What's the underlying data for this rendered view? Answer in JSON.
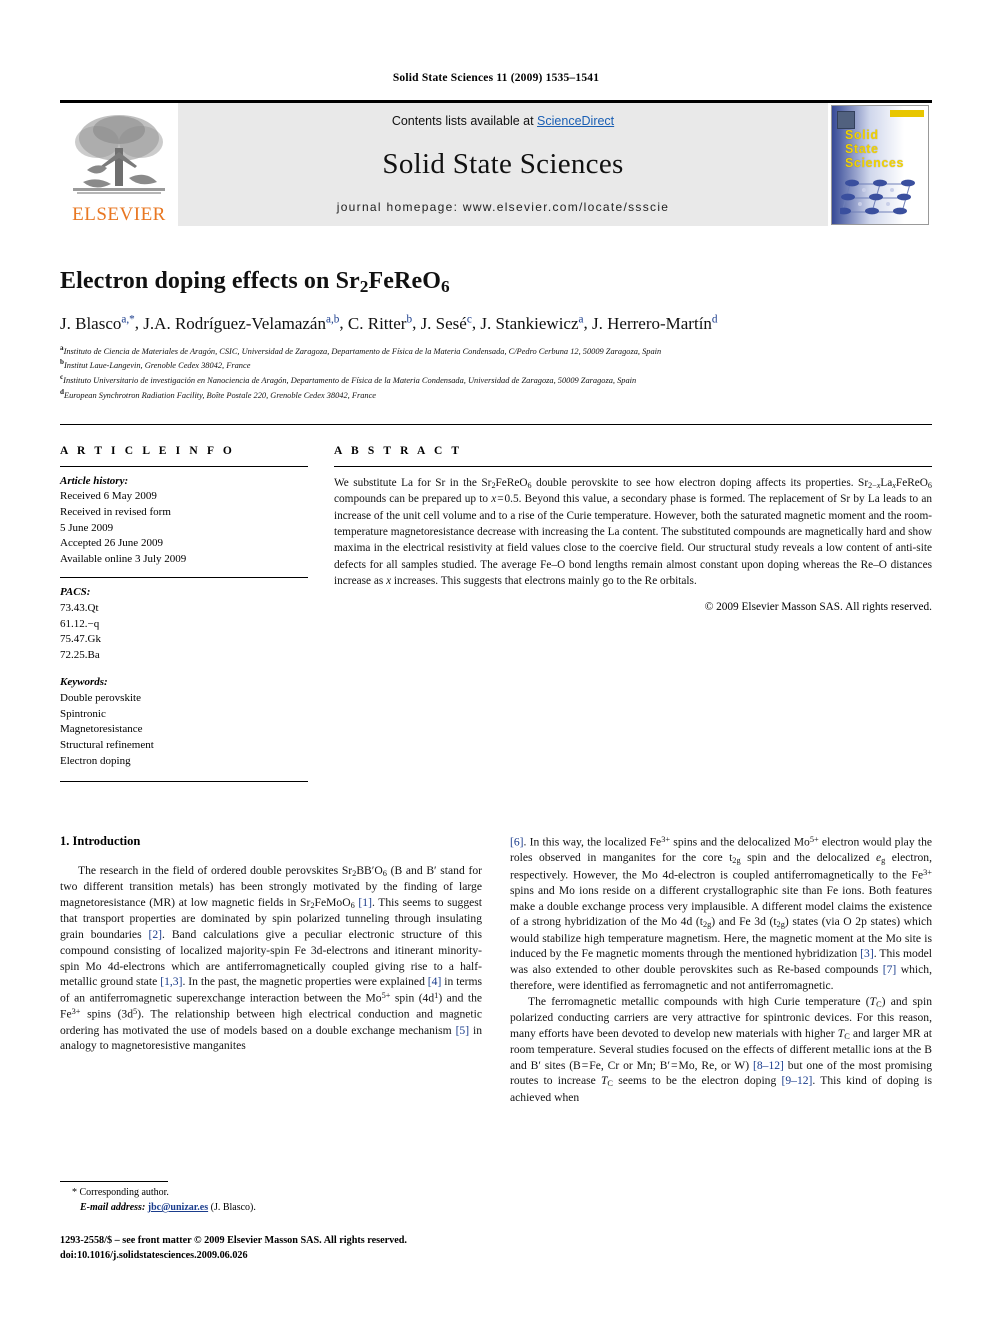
{
  "running_head": "Solid State Sciences 11 (2009) 1535–1541",
  "banner": {
    "publisher_name": "ELSEVIER",
    "contents_prefix": "Contents lists available at ",
    "contents_link": "ScienceDirect",
    "journal_name": "Solid State Sciences",
    "homepage": "journal homepage: www.elsevier.com/locate/ssscie",
    "cover_title_line1": "Solid",
    "cover_title_line2": "State",
    "cover_title_line3": "Sciences"
  },
  "article": {
    "title_main": "Electron doping effects on Sr",
    "title_sub1": "2",
    "title_mid": "FeReO",
    "title_sub2": "6",
    "authors": [
      {
        "name": "J. Blasco",
        "sup": "a,*"
      },
      {
        "name": "J.A. Rodríguez-Velamazán",
        "sup": "a,b"
      },
      {
        "name": "C. Ritter",
        "sup": "b"
      },
      {
        "name": "J. Sesé",
        "sup": "c"
      },
      {
        "name": "J. Stankiewicz",
        "sup": "a"
      },
      {
        "name": "J. Herrero-Martín",
        "sup": "d"
      }
    ],
    "affiliations": [
      {
        "mark": "a",
        "text": "Instituto de Ciencia de Materiales de Aragón, CSIC, Universidad de Zaragoza, Departamento de Física de la Materia Condensada, C/Pedro Cerbuna 12, 50009 Zaragoza, Spain"
      },
      {
        "mark": "b",
        "text": "Institut Laue-Langevin, Grenoble Cedex 38042, France"
      },
      {
        "mark": "c",
        "text": "Instituto Universitario de investigación en Nanociencia de Aragón, Departamento de Física de la Materia Condensada, Universidad de Zaragoza, 50009 Zaragoza, Spain"
      },
      {
        "mark": "d",
        "text": "European Synchrotron Radiation Facility, Boîte Postale 220, Grenoble Cedex 38042, France"
      }
    ]
  },
  "article_info": {
    "heading": "A R T I C L E   I N F O",
    "history_label": "Article history:",
    "history": [
      "Received 6 May 2009",
      "Received in revised form",
      "5 June 2009",
      "Accepted 26 June 2009",
      "Available online 3 July 2009"
    ],
    "pacs_label": "PACS:",
    "pacs": [
      "73.43.Qt",
      "61.12.−q",
      "75.47.Gk",
      "72.25.Ba"
    ],
    "keywords_label": "Keywords:",
    "keywords": [
      "Double perovskite",
      "Spintronic",
      "Magnetoresistance",
      "Structural refinement",
      "Electron doping"
    ]
  },
  "abstract": {
    "heading": "A B S T R A C T",
    "copyright": "© 2009 Elsevier Masson SAS. All rights reserved."
  },
  "body": {
    "section_number_title": "1. Introduction",
    "left_paragraph_refs": [
      "[1]",
      "[2]",
      "[1,3]",
      "[4]",
      "[5]"
    ],
    "right_paragraph_refs": [
      "[6]",
      "[3]",
      "[7]",
      "[8–12]",
      "[9–12]"
    ]
  },
  "footnotes": {
    "corresponding_mark": "*",
    "corresponding_text": "Corresponding author.",
    "email_label": "E-mail address:",
    "email": "jbc@unizar.es",
    "email_owner": "(J. Blasco).",
    "issn_line": "1293-2558/$ – see front matter © 2009 Elsevier Masson SAS. All rights reserved.",
    "doi_line": "doi:10.1016/j.solidstatesciences.2009.06.026"
  }
}
